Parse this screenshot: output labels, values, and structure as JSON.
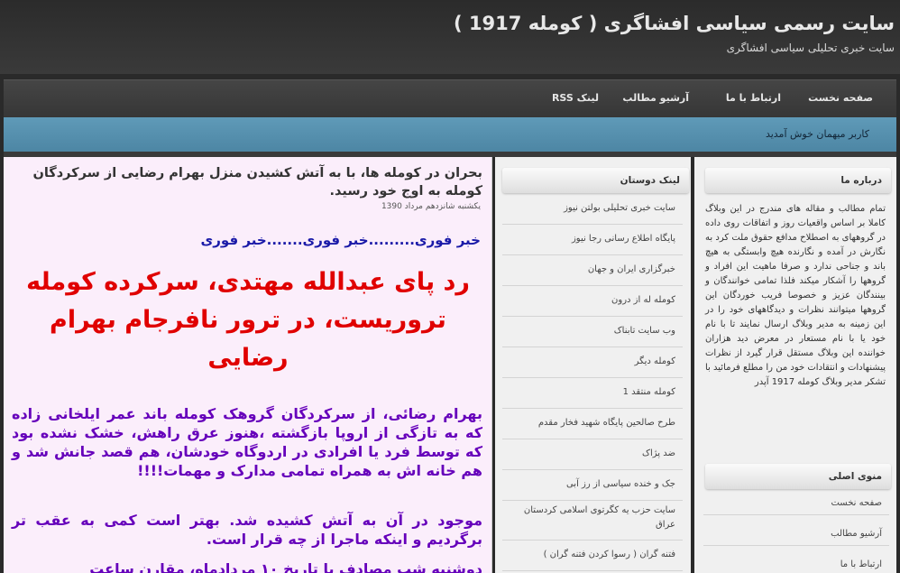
{
  "header": {
    "title": "سایت رسمی سیاسی افشاگری ( کومله 1917 )",
    "description": "سایت خبری تحلیلی سیاسی افشاگری"
  },
  "nav": {
    "items": [
      "صفحه نخست",
      "ارتباط با ما",
      "آرشیو مطالب",
      "لینک RSS"
    ]
  },
  "welcome": "کاربر میهمان خوش آمدید",
  "post": {
    "title": "بحران در کومله ها، با به آتش کشیدن منزل بهرام رضایی از سرکردگان کومله به اوج خود رسید.",
    "date": "یکشنبه شانزدهم مرداد 1390",
    "breaking": "خبر فوری.........خبر فوری.......خبر فوری",
    "headline": "رد پای عبدالله مهتدی، سرکرده کومله تروریست، در ترور نافرجام بهرام رضایی",
    "paragraph1": "بهرام رضائی، از سرکردگان گروهک کومله باند عمر ایلخانی زاده که به تازگی از اروپا بازگشته ،هنوز عرق راهش، خشک نشده بود که توسط فرد یا افرادی در اردوگاه خودشان، هم قصد جانش شد و هم خانه اش به همراه تمامی مدارک و مهمات!!!!",
    "paragraph2": "موجود در آن به آتش کشیده شد. بهتر است کمی به عقب تر برگردیم و اینکه ماجرا از چه قرار است.",
    "paragraph3": "دوشنبه شب مصادف با تاریخ ۱۰ مردادماه، مقارن ساعت"
  },
  "friends": {
    "heading": "لینک دوستان",
    "links": [
      "سایت خبری تحلیلی بولتن نیوز",
      "پایگاه اطلاع رسانی رجا نیوز",
      "خبرگزاری ایران و جهان",
      "کومله له از درون",
      "وب سایت تابناک",
      "کومله دیگر",
      "کومله منتقد 1",
      "طرح صالحین پایگاه شهید فخار مقدم",
      "ضد پژاک",
      "جک و خنده سیاسی از رز آبی",
      "سایت حزب یه کگرتوی اسلامی کردستان عراق",
      "فتنه گران ( رسوا کردن فتنه گران )"
    ]
  },
  "about": {
    "heading": "درباره ما",
    "text": "تمام مطالب و مقاله های مندرج در این وبلاگ کاملا بر اساس واقعیات روز و اتفاقات روی داده در گروههای به اصطلاح مدافع حقوق ملت کرد به نگارش در آمده و نگارنده هیچ وابستگی به هیچ باند و جناحی ندارد و صرفا ماهیت این افراد و گروهها را آشکار میکند فلذا تمامی خوانندگان و بینندگان عزیز و خصوصا فریب خوردگان این گروهها میتوانند نظرات و دیدگاههای خود را در این زمینه به مدیر وبلاگ ارسال نمایند تا با نام خود یا با نام مستعار در معرض دید هزاران خواننده این وبلاگ مستقل قرار گیرد از نظرات پیشنهادات و انتقادات خود من را مطلع فرمائید با تشکر مدیر وبلاگ کومله 1917 آپدر"
  },
  "main_menu": {
    "heading": "منوی اصلی",
    "items": [
      "صفحه نخست",
      "آرشیو مطالب",
      "ارتباط با ما"
    ]
  }
}
